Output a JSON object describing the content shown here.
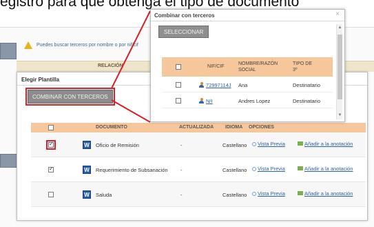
{
  "top_text": "egistro para que obtenga el tipo de documento",
  "warning_text": "Puedes buscar terceros por nombre o por nif/cif",
  "relacion_label": "RELACIÓN",
  "dialog": {
    "title": "Elegir Plantilla",
    "combinar_button": "COMBINAR CON TERCEROS",
    "columns": [
      "DOCUMENTO",
      "ACTUALIZADA",
      "IDIOMA",
      "OPCIONES"
    ],
    "rows": [
      {
        "documento": "Oficio de Remisión",
        "actualizada": "-",
        "idioma": "Castellano",
        "vista_previa": "Vista Previa",
        "anadir": "Añadir a la anotación",
        "checked": true
      },
      {
        "documento": "Requerimiento de Subsanación",
        "actualizada": "-",
        "idioma": "Castellano",
        "vista_previa": "Vista Previa",
        "anadir": "Añadir a la anotación",
        "checked": true
      },
      {
        "documento": "Saluda",
        "actualizada": "-",
        "idioma": "Castellano",
        "vista_previa": "Vista Previa",
        "anadir": "Añadir a la anotación",
        "checked": false
      }
    ]
  },
  "popup": {
    "title": "Combinar con terceros",
    "close": "×",
    "seleccionar_button": "SELECCIONAR",
    "columns": {
      "nif": "NIF/CIF",
      "nombre": "NOMBRE/RAZÓN SOCIAL",
      "tipo": "TIPO DE 3º"
    },
    "rows": [
      {
        "nif": "72997114J",
        "nombre": "Ana",
        "tipo": "Destinatario"
      },
      {
        "nif": "N/I",
        "nombre": "Andres Lopez",
        "tipo": "Destinatario"
      }
    ]
  },
  "icons": {
    "word": "W",
    "scroll_up": "▲",
    "scroll_down": "▼"
  },
  "colors": {
    "accent_orange": "#f5c79a",
    "highlight_red": "#d6202a",
    "button_gray": "#8c8c8c",
    "link_blue": "#2a62b4"
  }
}
